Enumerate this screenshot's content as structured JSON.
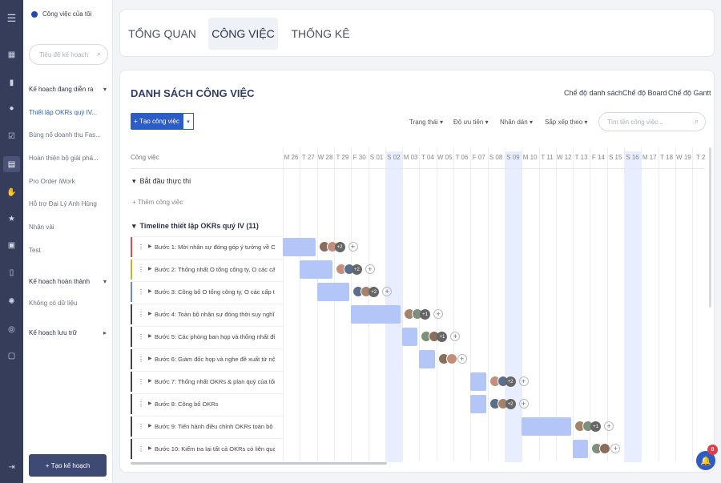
{
  "sidebar": {
    "title": "Công việc của tôi",
    "search_placeholder": "Tiêu đề kế hoạch",
    "groups": [
      {
        "label": "Kế hoạch đang diễn ra",
        "items": [
          "Thiết lập OKRs quý IV...",
          "Bùng nổ doanh thu Fas...",
          "Hoàn thiện bộ giải phá...",
          "Pro Order iWork",
          "Hỗ trợ Đại Lý Anh Hùng",
          "Nhận vải",
          "Test"
        ]
      },
      {
        "label": "Kế hoạch hoàn thành",
        "items": [
          "Không có dữ liệu"
        ]
      },
      {
        "label": "Kế hoạch lưu trữ",
        "items": []
      }
    ],
    "new_plan_label": "Tạo kế hoạch"
  },
  "tabs": [
    "TỔNG QUAN",
    "CÔNG VIỆC",
    "THỐNG KÊ"
  ],
  "active_tab": 1,
  "main": {
    "title": "DANH SÁCH CÔNG VIỆC",
    "views": [
      "Chế độ danh sách",
      "Chế độ Board",
      "Chế độ Gantt"
    ],
    "new_task_label": "Tạo công việc",
    "filters": [
      "Trạng thái",
      "Độ ưu tiên",
      "Nhãn dán",
      "Sắp xếp theo"
    ],
    "search_placeholder": "Tìm tên công việc...",
    "column_header": "Công việc",
    "days": [
      "M 26",
      "T 27",
      "W 28",
      "T 29",
      "F 30",
      "S 01",
      "S 02",
      "M 03",
      "T 04",
      "W 05",
      "T 06",
      "F 07",
      "S 08",
      "S 09",
      "M 10",
      "T 11",
      "W 12",
      "T 13",
      "F 14",
      "S 15",
      "S 16",
      "M 17",
      "T 18",
      "W 19",
      "T 2"
    ],
    "weekend_days": [
      6,
      13,
      20
    ],
    "sections": [
      {
        "label": "Bắt đầu thực thi",
        "add_label": "Thêm công việc"
      },
      {
        "label": "Timeline thiết lập OKRs quý IV (11)"
      }
    ],
    "tasks": [
      {
        "label": "Bước 1: Mời nhân sự đóng góp ý tưởng về O...",
        "stripe": "#e04b4b",
        "start": 0,
        "span": 2,
        "extra": "+2"
      },
      {
        "label": "Bước 2: Thống nhất O tổng công ty, O các cấp...",
        "stripe": "#c9b22a",
        "start": 1,
        "span": 2,
        "extra": "+2"
      },
      {
        "label": "Bước 3: Công bố O tổng công ty, O các cấp t...",
        "stripe": "#6a86d6",
        "start": 2,
        "span": 2,
        "extra": "+2"
      },
      {
        "label": "Bước 4: Toàn bộ nhân sự đóng thời suy nghĩ...",
        "stripe": "#444",
        "start": 4,
        "span": 3,
        "extra": "+1"
      },
      {
        "label": "Bước 5: Các phòng ban họp và thống nhất đề...",
        "stripe": "#444",
        "start": 7,
        "span": 1,
        "extra": "+1"
      },
      {
        "label": "Bước 6: Giám đốc họp và nghe đề xuất từ nội...",
        "stripe": "#444",
        "start": 8,
        "span": 1,
        "extra": ""
      },
      {
        "label": "Bước 7: Thống nhất OKRs & plan quý của tổng...",
        "stripe": "#444",
        "start": 11,
        "span": 1,
        "extra": "+2"
      },
      {
        "label": "Bước 8: Công bố OKRs",
        "stripe": "#444",
        "start": 11,
        "span": 1,
        "extra": "+2"
      },
      {
        "label": "Bước 9: Tiến hành điều chỉnh OKRs toàn bộ n...",
        "stripe": "#444",
        "start": 14,
        "span": 3,
        "extra": "+1"
      },
      {
        "label": "Bước 10: Kiểm tra lại tất cả OKRs có liên quan...",
        "stripe": "#444",
        "start": 17,
        "span": 1,
        "extra": ""
      }
    ]
  },
  "notification_count": "8",
  "colors": {
    "accent": "#2c5cc5",
    "rail": "#353d5a",
    "bar": "#b4c6f7",
    "weekend": "#e8eeff"
  }
}
